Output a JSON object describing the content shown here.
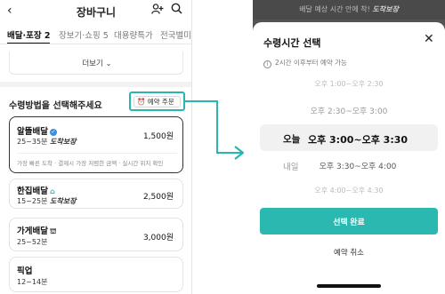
{
  "left": {
    "header": {
      "back_icon": "chevron-left-icon",
      "title": "장바구니",
      "add_user_icon": "person-add-icon",
      "search_icon": "search-icon"
    },
    "tabs": [
      "배달·포장 2",
      "장보기·쇼핑 5",
      "대용량특가",
      "전국별미"
    ],
    "more_label": "더보기",
    "section_title": "수령방법을 선택해주세요",
    "reserve_button": "예약 주문",
    "options": [
      {
        "name": "알뜰배달",
        "time": "25~35분",
        "guarantee": "도착보장",
        "price": "1,500원",
        "description": "가장 빠른 도착 · 결제시 가장 저렴한 금액 · 실시간 위치 확인",
        "selected": true
      },
      {
        "name": "한집배달",
        "time": "15~25분",
        "guarantee": "도착보장",
        "price": "2,500원",
        "selected": false
      },
      {
        "name": "가게배달",
        "time": "25~52분",
        "guarantee": "",
        "price": "3,000원",
        "selected": false
      },
      {
        "name": "픽업",
        "time": "12~14분",
        "guarantee": "",
        "price": "",
        "selected": false
      }
    ]
  },
  "right": {
    "banner": {
      "text": "배달 예상 시간 안에 착!",
      "brand": "도착보장"
    },
    "sheet": {
      "title": "수령시간 선택",
      "close_icon": "close-icon",
      "info": "2시간 이후부터 예약 가능",
      "time_slots": [
        "오후 1:00~오후 2:30",
        "오후 2:30~오후 3:00",
        "오후 3:00~오후 3:30",
        "오후 3:30~오후 4:00",
        "오후 4:00~오후 4:30"
      ],
      "days": [
        "오늘",
        "내일"
      ],
      "selected_slot": "오후 3:00~오후 3:30",
      "confirm_button": "선택 완료",
      "cancel_button": "예약 취소"
    }
  },
  "colors": {
    "accent": "#2bb8b1",
    "overlay": "#545454"
  }
}
